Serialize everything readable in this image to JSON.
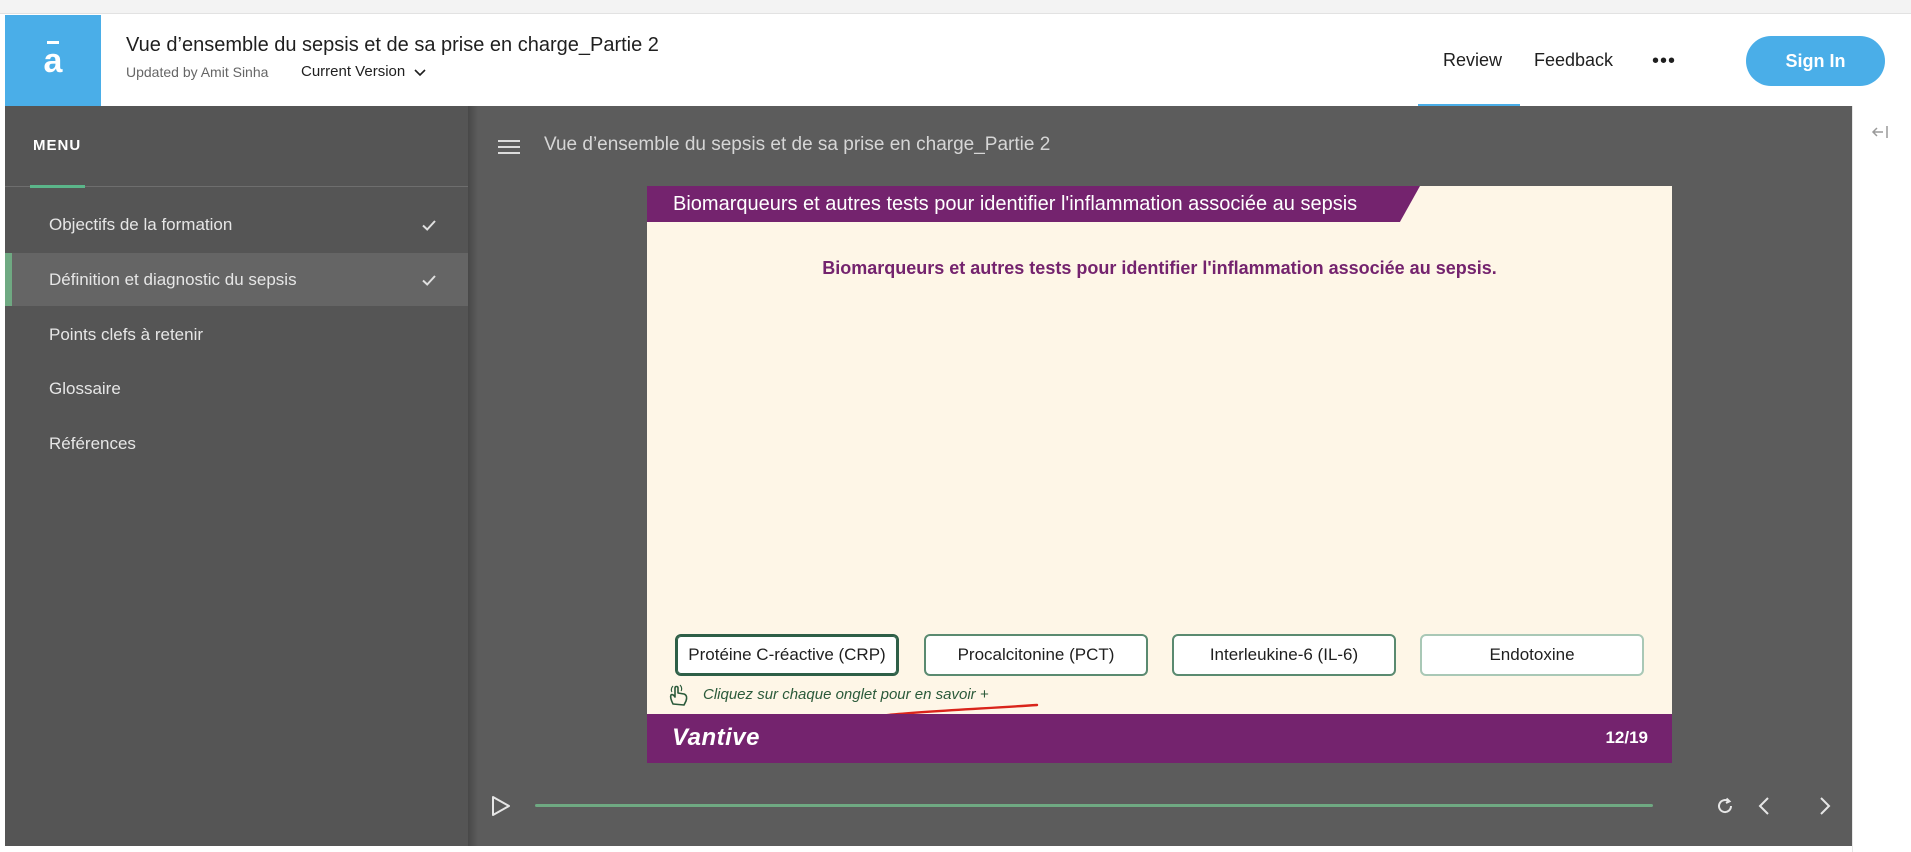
{
  "header": {
    "logo_glyph": "a",
    "course_title": "Vue d’ensemble du sepsis et de sa prise en charge_Partie 2",
    "updated_by": "Updated by Amit Sinha",
    "version_label": "Current Version",
    "review_label": "Review",
    "feedback_label": "Feedback",
    "more_label": "•••",
    "signin_label": "Sign In"
  },
  "sidebar": {
    "title": "MENU",
    "items": [
      {
        "label": "Objectifs de la formation",
        "completed": true
      },
      {
        "label": "Définition et diagnostic du sepsis",
        "completed": true,
        "active": true
      },
      {
        "label": "Points clefs à retenir",
        "completed": false
      },
      {
        "label": "Glossaire",
        "completed": false
      },
      {
        "label": "Références",
        "completed": false
      }
    ]
  },
  "player": {
    "title": "Vue d’ensemble du sepsis et de sa prise en charge_Partie 2",
    "slide": {
      "banner": "Biomarqueurs et autres tests pour identifier l'inflammation associée au sepsis",
      "subtitle": "Biomarqueurs et autres tests pour identifier l'inflammation associée au sepsis.",
      "tabs": [
        "Protéine C-réactive (CRP)",
        "Procalcitonine (PCT)",
        "Interleukine-6 (IL-6)",
        "Endotoxine"
      ],
      "hint": "Cliquez sur chaque onglet pour en savoir +",
      "brand": "Vantive",
      "page": "12/19"
    },
    "progress_fraction": 1.0
  },
  "colors": {
    "accent_blue": "#4aaee8",
    "slide_purple": "#74236e",
    "sidebar_bg": "#555555",
    "player_bg": "#5c5c5c",
    "green_accent": "#6fa982"
  },
  "icons": {
    "check": "check-icon",
    "hamburger": "hamburger-icon",
    "play": "play-icon",
    "replay": "replay-icon",
    "prev": "chevron-left-icon",
    "next": "chevron-right-icon",
    "collapse": "collapse-panel-icon",
    "hint": "hand-pointer-icon"
  }
}
